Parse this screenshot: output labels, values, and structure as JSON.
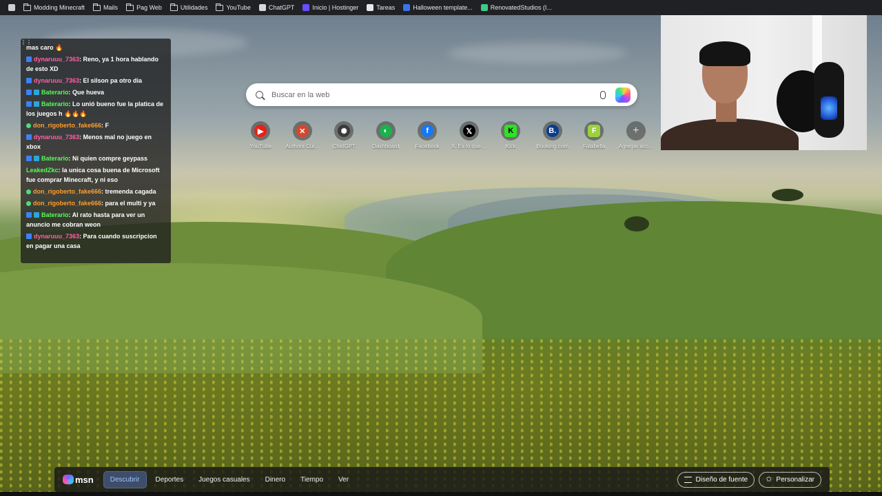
{
  "bookmarks": [
    {
      "label": "",
      "icon": "reading-list-icon"
    },
    {
      "label": "Modding Minecraft",
      "icon": "folder-icon"
    },
    {
      "label": "Mails",
      "icon": "folder-icon"
    },
    {
      "label": "Pag Web",
      "icon": "folder-icon"
    },
    {
      "label": "Utilidades",
      "icon": "folder-icon"
    },
    {
      "label": "YouTube",
      "icon": "folder-icon"
    },
    {
      "label": "ChatGPT",
      "icon": "chatgpt-icon"
    },
    {
      "label": "Inicio | Hostinger",
      "icon": "hostinger-icon"
    },
    {
      "label": "Tareas",
      "icon": "notion-icon"
    },
    {
      "label": "Halloween template...",
      "icon": "doc-icon"
    },
    {
      "label": "RenovatedStudios (I...",
      "icon": "studio-icon"
    }
  ],
  "chat": {
    "partial_line": "mas caro 🔥",
    "messages": [
      {
        "user": "dynaruuu_7363",
        "color": "pink",
        "text": ": Reno, ya 1 hora hablando de esto XD"
      },
      {
        "user": "dynaruuu_7363",
        "color": "pink",
        "text": ": El silson pa otro dia"
      },
      {
        "user": "Baterario",
        "color": "green",
        "text": ": Que hueva"
      },
      {
        "user": "Baterario",
        "color": "green",
        "text": ": Lo unió bueno fue la platica de los juegos h 🔥🔥🔥"
      },
      {
        "user": "don_rigoberto_fake666",
        "color": "orange",
        "text": ": F"
      },
      {
        "user": "dynaruuu_7363",
        "color": "pink",
        "text": ": Menos mal no juego en xbox"
      },
      {
        "user": "Baterario",
        "color": "green",
        "text": ": Ni quien compre geypass"
      },
      {
        "user": "LeakedZkc",
        "color": "green",
        "text": ": la unica cosa buena de Microsoft fue comprar Minecraft, y ni eso"
      },
      {
        "user": "don_rigoberto_fake666",
        "color": "orange",
        "text": ": tremenda cagada"
      },
      {
        "user": "don_rigoberto_fake666",
        "color": "orange",
        "text": ": para el multi y ya"
      },
      {
        "user": "Baterario",
        "color": "green",
        "text": ": Al rato hasta para ver un anuncio me cobran weon"
      },
      {
        "user": "dynaruuu_7363",
        "color": "pink",
        "text": ": Para cuando suscripcion en pagar una casa"
      }
    ]
  },
  "search": {
    "placeholder": "Buscar en la web"
  },
  "quick_links": [
    {
      "label": "YouTube",
      "icon": "youtube-icon",
      "bg": "#e62117",
      "glyph": "▶"
    },
    {
      "label": "Authors Cur...",
      "icon": "authors-icon",
      "bg": "#d9452b",
      "glyph": "✕"
    },
    {
      "label": "ChatGPT",
      "icon": "chatgpt-icon",
      "bg": "#3a3a3a",
      "glyph": "✺"
    },
    {
      "label": "Dashboard",
      "icon": "dashboard-icon",
      "bg": "#19b34a",
      "glyph": "◐"
    },
    {
      "label": "Facebook",
      "icon": "facebook-icon",
      "bg": "#1877f2",
      "glyph": "f"
    },
    {
      "label": "X. Es lo que ...",
      "icon": "x-icon",
      "bg": "#000000",
      "glyph": "𝕏"
    },
    {
      "label": "Kick",
      "icon": "kick-icon",
      "bg": "#2ee321",
      "glyph": "K"
    },
    {
      "label": "Booking.com",
      "icon": "booking-icon",
      "bg": "#0b3b8f",
      "glyph": "B."
    },
    {
      "label": "Falabella",
      "icon": "falabella-icon",
      "bg": "#9bd13a",
      "glyph": "F"
    },
    {
      "label": "Agregar acc...",
      "icon": "plus-icon",
      "bg": "transparent",
      "glyph": "+"
    }
  ],
  "nav": {
    "brand": "msn",
    "tabs": [
      "Descubrir",
      "Deportes",
      "Juegos casuales",
      "Dinero",
      "Tiempo",
      "Ver"
    ],
    "active_tab": "Descubrir",
    "feed_design_label": "Diseño de fuente",
    "personalize_label": "Personalizar"
  }
}
